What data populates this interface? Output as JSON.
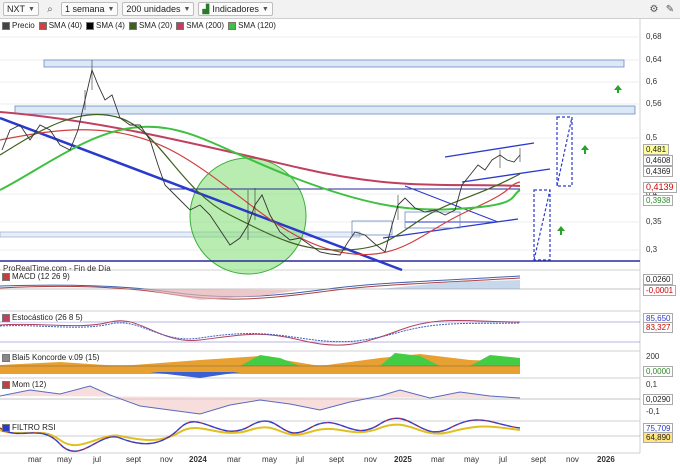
{
  "toolbar": {
    "symbol": "NXT",
    "period": "1 semana",
    "units": "200 unidades",
    "indicators": "Indicadores"
  },
  "legend": [
    {
      "label": "Precio",
      "color": "#444444"
    },
    {
      "label": "SMA (40)",
      "color": "#d04040"
    },
    {
      "label": "SMA (4)",
      "color": "#000000"
    },
    {
      "label": "SMA (20)",
      "color": "#406020"
    },
    {
      "label": "SMA (200)",
      "color": "#c04060"
    },
    {
      "label": "SMA (120)",
      "color": "#40c040"
    }
  ],
  "yaxis": [
    "0,68",
    "0,64",
    "0,6",
    "0,56",
    "0,52",
    "0,5",
    "0,4",
    "0,35",
    "0,3"
  ],
  "price_tags": [
    {
      "text": "0,481",
      "bg": "#ffff99",
      "color": "#000"
    },
    {
      "text": "0,4608",
      "bg": "#ffffff",
      "color": "#000"
    },
    {
      "text": "0,4369",
      "bg": "#ffffff",
      "color": "#000"
    },
    {
      "text": "0,4139",
      "bg": "#ffffff",
      "color": "#d00000"
    },
    {
      "text": "0,3938",
      "bg": "#ffffff",
      "color": "#2a8a2a"
    }
  ],
  "source": "ProRealTime.com - Fin de Día",
  "panes": {
    "macd": {
      "label": "MACD (12 26 9)",
      "v1": "0,0260",
      "v2": "-0,0001"
    },
    "stoch": {
      "label": "Estocástico (26 8 5)",
      "v1": "85,650",
      "v2": "83,327"
    },
    "koncorde": {
      "label": "Blai5 Koncorde v.09 (15)",
      "v1": "200",
      "v2": "0,0000"
    },
    "mom": {
      "label": "Mom (12)",
      "v1": "0,1",
      "v2": "0,0290",
      "v3": "-0,1"
    },
    "filtro": {
      "label": "FILTRO RSI",
      "v1": "75,709",
      "v2": "64,890"
    }
  },
  "xaxis": [
    "mar",
    "may",
    "jul",
    "sept",
    "nov",
    "2024",
    "mar",
    "may",
    "jul",
    "sept",
    "nov",
    "2025",
    "mar",
    "may",
    "jul",
    "sept",
    "nov",
    "2026"
  ]
}
